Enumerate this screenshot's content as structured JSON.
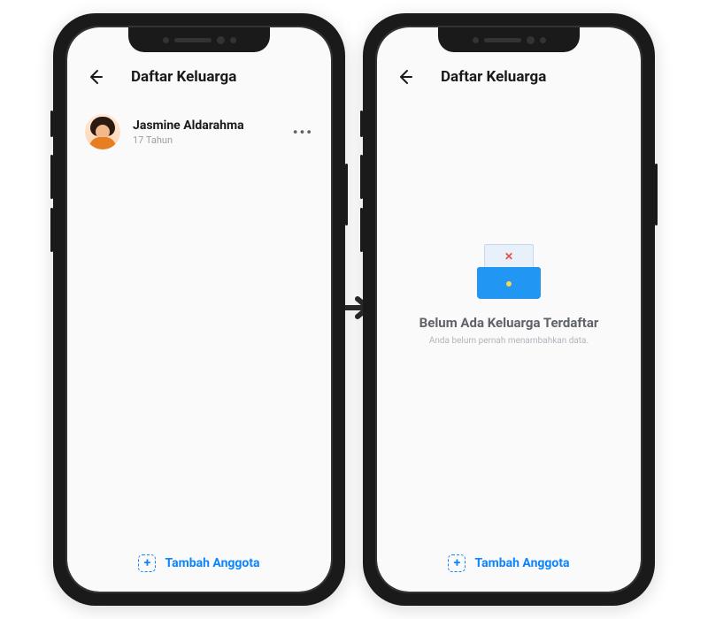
{
  "left_screen": {
    "header": {
      "title": "Daftar Keluarga"
    },
    "members": [
      {
        "name": "Jasmine Aldarahma",
        "subtitle": "17 Tahun"
      }
    ],
    "footer": {
      "add_label": "Tambah Anggota"
    }
  },
  "right_screen": {
    "header": {
      "title": "Daftar Keluarga"
    },
    "empty": {
      "title": "Belum Ada Keluarga Terdaftar",
      "subtitle": "Anda belum pernah menambahkan data."
    },
    "footer": {
      "add_label": "Tambah Anggota"
    }
  },
  "colors": {
    "primary": "#0a84ff",
    "text_dark": "#1a1a1a",
    "text_muted": "#9aa0a6",
    "illus_blue": "#2196f3"
  }
}
